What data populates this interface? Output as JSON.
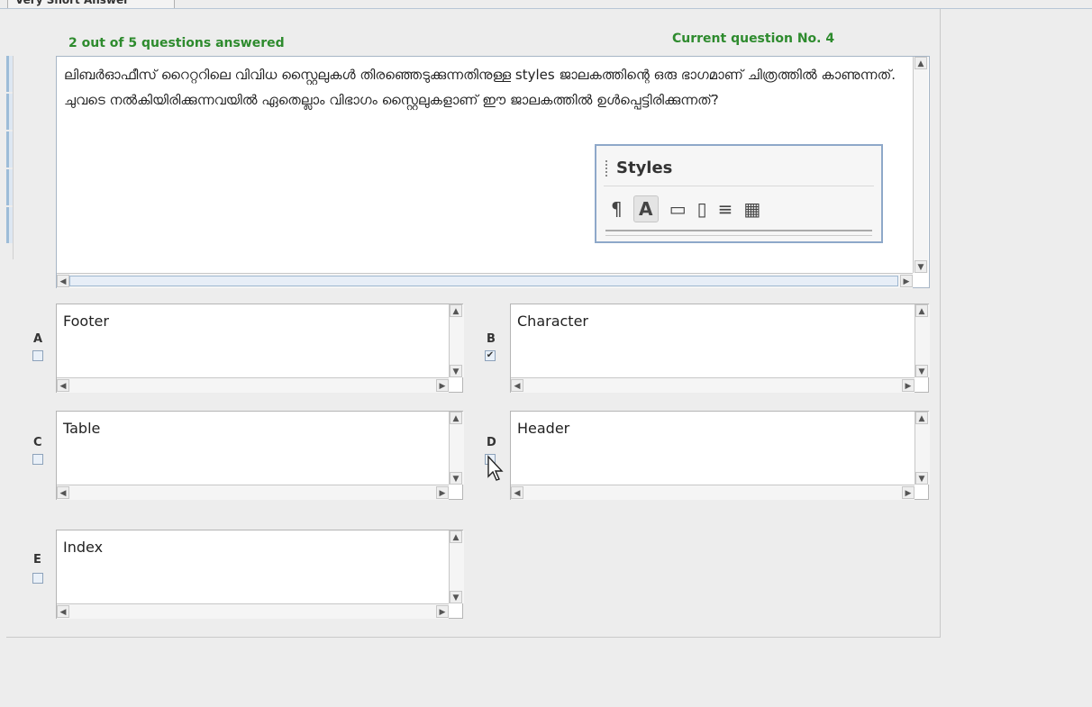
{
  "tab": {
    "label": "Very Short Answer"
  },
  "status": {
    "answered": "2 out of 5 questions answered",
    "current": "Current question No. 4"
  },
  "question": {
    "text": "ലിബർഓഫീസ് റൈറ്ററിലെ വിവിധ സ്റ്റൈലുകൾ തിരഞ്ഞെടുക്കുന്നതിനുള്ള styles ജാലകത്തിന്റെ ഒരു ഭാഗമാണ് ചിത്രത്തിൽ കാണുന്നത്. ചുവടെ നൽകിയിരിക്കുന്നവയിൽ ഏതെല്ലാം വിഭാഗം സ്റ്റൈലുകളാണ് ഈ ജാലകത്തിൽ ഉൾപ്പെട്ടിരിക്കുന്നത്?",
    "image": {
      "title": "Styles"
    }
  },
  "options": [
    {
      "letter": "A",
      "text": "Footer",
      "checked": false
    },
    {
      "letter": "B",
      "text": "Character",
      "checked": true
    },
    {
      "letter": "C",
      "text": "Table",
      "checked": false
    },
    {
      "letter": "D",
      "text": "Header",
      "checked": false
    },
    {
      "letter": "E",
      "text": "Index",
      "checked": false
    }
  ],
  "colors": {
    "status": "#2e8b2e",
    "border": "#a7b6c6"
  }
}
